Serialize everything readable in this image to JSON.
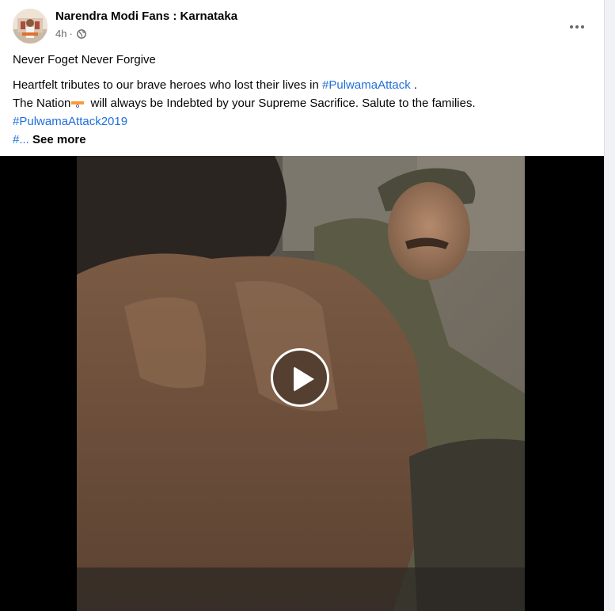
{
  "post": {
    "page_name": "Narendra Modi Fans : Karnataka",
    "time": "4h",
    "separator": "·",
    "privacy_icon": "globe-icon",
    "more_icon": "more-horizontal-icon",
    "text": {
      "line1": "Never Foget Never Forgive",
      "line2_prefix": "Heartfelt tributes to our brave heroes who lost their lives in",
      "hashtag1": "#PulwamaAttack",
      "line2_suffix": ".",
      "line3_prefix": "The Nation",
      "flag_icon": "india-flag-icon",
      "line3_suffix": "will always be Indebted by your Supreme Sacrifice. Salute to the families.",
      "hashtag2": "#PulwamaAttack2019",
      "truncated_hashtag": "#...",
      "see_more": "See more"
    }
  },
  "video": {
    "play_icon": "play-icon",
    "accent": "#ffffff"
  },
  "colors": {
    "hashtag": "#216fdb",
    "primary_text": "#050505",
    "secondary_text": "#65676b",
    "background": "#f0f2f5"
  }
}
